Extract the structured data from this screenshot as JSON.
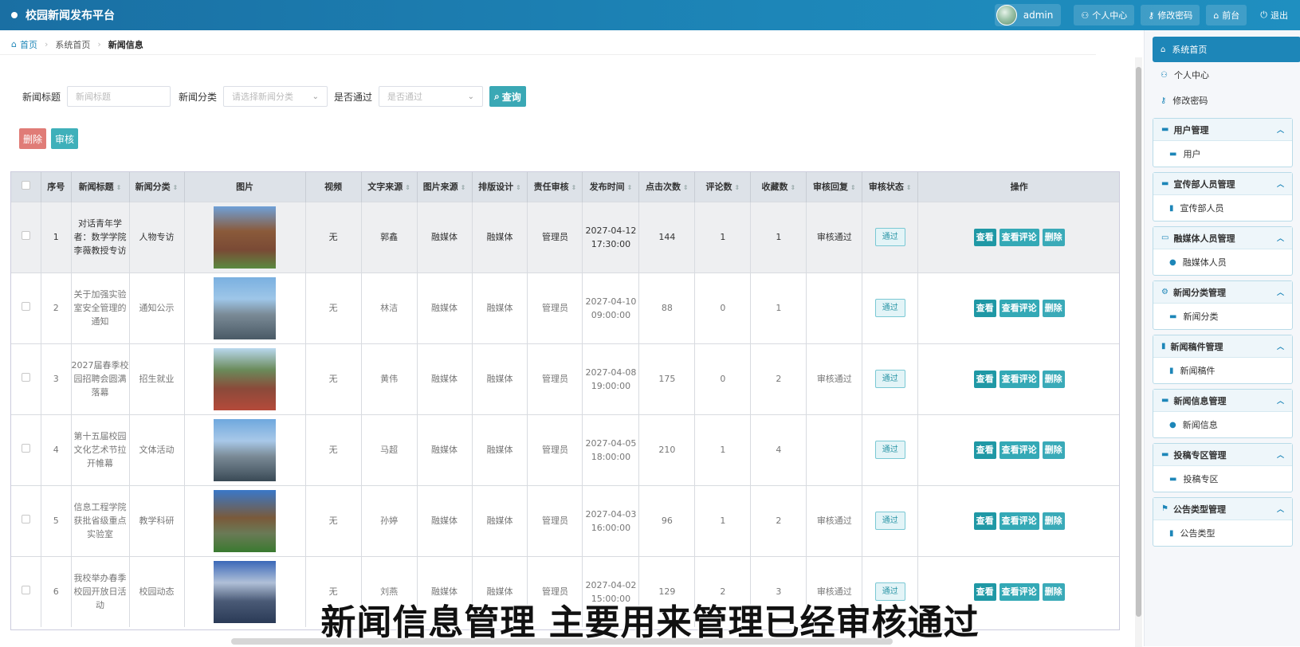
{
  "app": {
    "title": "校园新闻发布平台"
  },
  "topbar": {
    "user": "admin",
    "buttons": [
      {
        "label": "个人中心",
        "icon": "user-icon"
      },
      {
        "label": "修改密码",
        "icon": "key-icon"
      },
      {
        "label": "前台",
        "icon": "home-icon"
      },
      {
        "label": "退出",
        "icon": "power-icon"
      }
    ]
  },
  "breadcrumb": {
    "home": "首页",
    "level2": "系统首页",
    "current": "新闻信息"
  },
  "search": {
    "title_label": "新闻标题",
    "title_placeholder": "新闻标题",
    "category_label": "新闻分类",
    "category_placeholder": "请选择新闻分类",
    "approved_label": "是否通过",
    "approved_placeholder": "是否通过",
    "query_label": "查询"
  },
  "actions": {
    "delete_label": "删除",
    "audit_label": "审核"
  },
  "table": {
    "headers": [
      "序号",
      "新闻标题",
      "新闻分类",
      "图片",
      "视频",
      "文字来源",
      "图片来源",
      "排版设计",
      "责任审核",
      "发布时间",
      "点击次数",
      "评论数",
      "收藏数",
      "审核回复",
      "审核状态",
      "操作"
    ],
    "op_labels": {
      "view": "查看",
      "comment": "查看评论",
      "delete": "删除"
    },
    "rows": [
      {
        "no": "1",
        "title": "对话青年学者：数学学院李薇教授专访",
        "category": "人物专访",
        "video": "无",
        "text_src": "郭鑫",
        "img_src": "融媒体",
        "layout": "融媒体",
        "reviewer": "管理员",
        "date": "2027-04-12",
        "time": "17:30:00",
        "clicks": "144",
        "comments": "1",
        "favs": "1",
        "reply": "审核通过",
        "status": "通过"
      },
      {
        "no": "2",
        "title": "关于加强实验室安全管理的通知",
        "category": "通知公示",
        "video": "无",
        "text_src": "林洁",
        "img_src": "融媒体",
        "layout": "融媒体",
        "reviewer": "管理员",
        "date": "2027-04-10",
        "time": "09:00:00",
        "clicks": "88",
        "comments": "0",
        "favs": "1",
        "reply": "",
        "status": "通过"
      },
      {
        "no": "3",
        "title": "2027届春季校园招聘会圆满落幕",
        "category": "招生就业",
        "video": "无",
        "text_src": "黄伟",
        "img_src": "融媒体",
        "layout": "融媒体",
        "reviewer": "管理员",
        "date": "2027-04-08",
        "time": "19:00:00",
        "clicks": "175",
        "comments": "0",
        "favs": "2",
        "reply": "审核通过",
        "status": "通过"
      },
      {
        "no": "4",
        "title": "第十五届校园文化艺术节拉开帷幕",
        "category": "文体活动",
        "video": "无",
        "text_src": "马超",
        "img_src": "融媒体",
        "layout": "融媒体",
        "reviewer": "管理员",
        "date": "2027-04-05",
        "time": "18:00:00",
        "clicks": "210",
        "comments": "1",
        "favs": "4",
        "reply": "",
        "status": "通过"
      },
      {
        "no": "5",
        "title": "信息工程学院获批省级重点实验室",
        "category": "教学科研",
        "video": "无",
        "text_src": "孙婷",
        "img_src": "融媒体",
        "layout": "融媒体",
        "reviewer": "管理员",
        "date": "2027-04-03",
        "time": "16:00:00",
        "clicks": "96",
        "comments": "1",
        "favs": "2",
        "reply": "审核通过",
        "status": "通过"
      },
      {
        "no": "6",
        "title": "我校举办春季校园开放日活动",
        "category": "校园动态",
        "video": "无",
        "text_src": "刘燕",
        "img_src": "融媒体",
        "layout": "融媒体",
        "reviewer": "管理员",
        "date": "2027-04-02",
        "time": "15:00:00",
        "clicks": "129",
        "comments": "2",
        "favs": "3",
        "reply": "审核通过",
        "status": "通过"
      }
    ]
  },
  "sidebar": {
    "top": [
      {
        "label": "系统首页",
        "icon": "home-icon",
        "active": true
      },
      {
        "label": "个人中心",
        "icon": "user-icon"
      },
      {
        "label": "修改密码",
        "icon": "key-icon"
      }
    ],
    "groups": [
      {
        "title": "用户管理",
        "icon": "briefcase-icon",
        "child": "用户",
        "child_icon": "briefcase-icon"
      },
      {
        "title": "宣传部人员管理",
        "icon": "briefcase-icon",
        "child": "宣传部人员",
        "child_icon": "chart-icon"
      },
      {
        "title": "融媒体人员管理",
        "icon": "monitor-icon",
        "child": "融媒体人员",
        "child_icon": "pin-icon"
      },
      {
        "title": "新闻分类管理",
        "icon": "gear-icon",
        "child": "新闻分类",
        "child_icon": "briefcase-icon"
      },
      {
        "title": "新闻稿件管理",
        "icon": "chart-icon",
        "child": "新闻稿件",
        "child_icon": "chart-icon"
      },
      {
        "title": "新闻信息管理",
        "icon": "briefcase-icon",
        "child": "新闻信息",
        "child_icon": "pin-icon"
      },
      {
        "title": "投稿专区管理",
        "icon": "briefcase-icon",
        "child": "投稿专区",
        "child_icon": "briefcase-icon"
      },
      {
        "title": "公告类型管理",
        "icon": "flag-icon",
        "child": "公告类型",
        "child_icon": "chart-icon"
      }
    ]
  },
  "subtitle": "新闻信息管理 主要用来管理已经审核通过"
}
